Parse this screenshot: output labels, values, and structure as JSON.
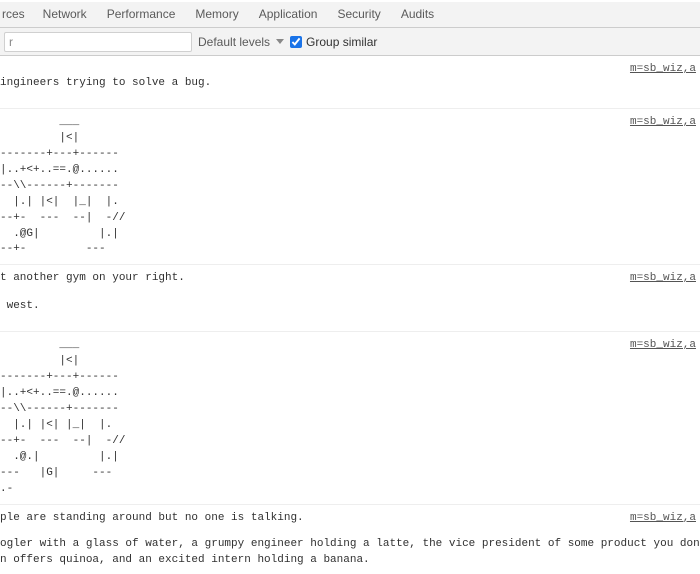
{
  "status_line": "",
  "tabs": {
    "partial": "rces",
    "network": "Network",
    "performance": "Performance",
    "memory": "Memory",
    "application": "Application",
    "security": "Security",
    "audits": "Audits"
  },
  "toolbar": {
    "filter_value": "r",
    "levels_label": "Default levels",
    "group_similar": "Group similar"
  },
  "source_link": "m=sb_wiz,a",
  "entries": {
    "e1": "ingineers trying to solve a bug.",
    "e2": "         ___\n         |<|\n-------+---+------\n|..+<+..==.@......\n--\\\\------+-------\n  |.| |<|  |_|  |.\n--+-  ---  --|  -//\n  .@G|         |.|\n--+-         ---",
    "e3_a": "t another gym on your right.",
    "e3_b": " west.",
    "e4": "         ___\n         |<|\n-------+---+------\n|..+<+..==.@......\n--\\\\------+-------\n  |.| |<| |_|  |.\n--+-  ---  --|  -//\n  .@.|         |.|\n---   |G|     ---\n.-",
    "e5_a": "ple are standing around but no one is talking.",
    "e5_b": "ogler with a glass of water, a grumpy engineer holding a latte, the vice president of some product you don't recognize with a diet coke\nn offers quinoa, and an excited intern holding a banana."
  }
}
